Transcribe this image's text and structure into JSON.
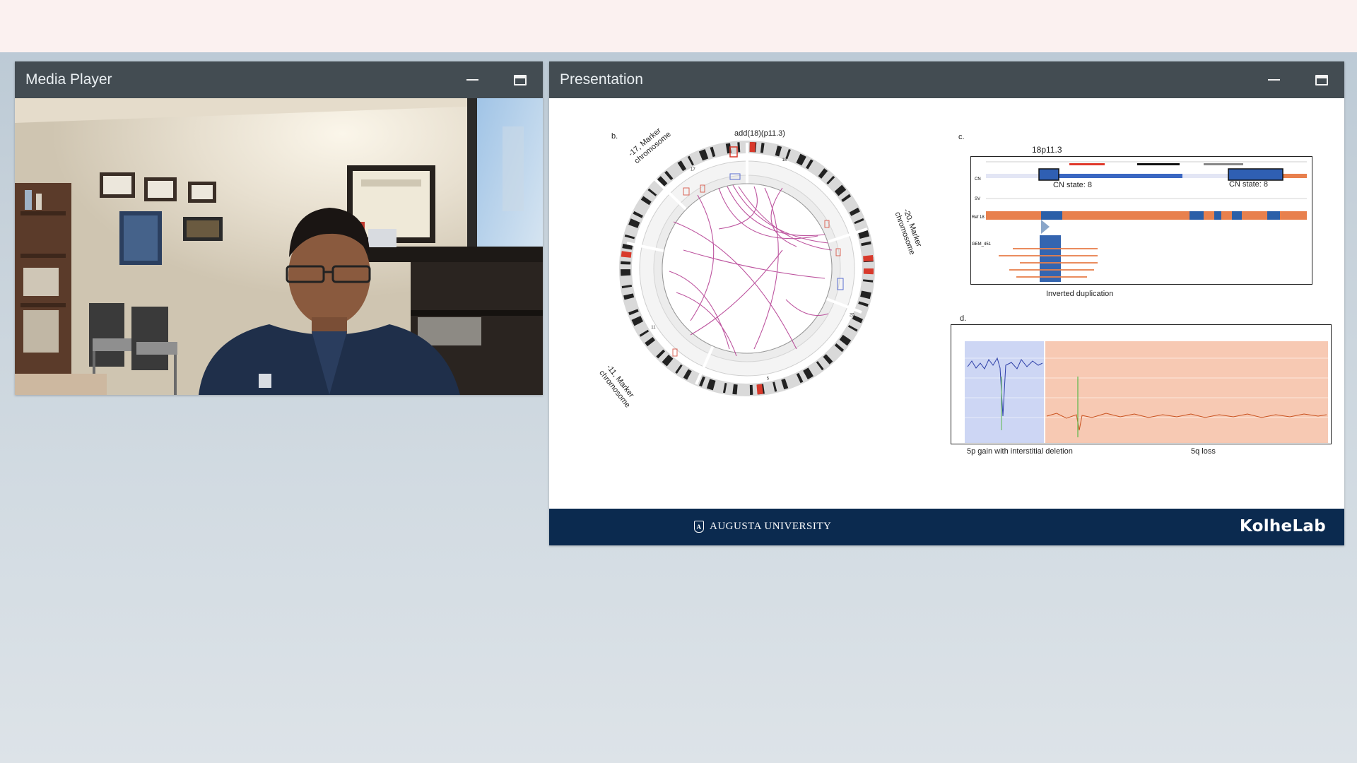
{
  "media_player": {
    "title": "Media Player"
  },
  "presentation": {
    "title": "Presentation",
    "slide": {
      "panel_b_label": "b.",
      "panel_c_label": "c.",
      "panel_d_label": "d.",
      "circos_top_label": "add(18)(p11.3)",
      "marker_17": "-17, Marker chromosome",
      "marker_20": "-20, Marker chromosome",
      "marker_11": "-11, Marker chromosome",
      "region_label": "18p11.3",
      "cn_state_left": "CN state: 8",
      "cn_state_right": "CN state: 8",
      "inverted_dup": "Inverted duplication",
      "gain_caption": "5p gain with interstitial deletion",
      "loss_caption": "5q loss",
      "track_cn": "CN",
      "track_sv": "SV",
      "track_ref": "Ref 18",
      "track_gem": "GEM_451",
      "chr_labels": [
        "18",
        "17",
        "20",
        "11",
        "5"
      ]
    },
    "footer": {
      "university": "AUGUSTA UNIVERSITY",
      "shield": "A",
      "lab": "KolheLab"
    }
  },
  "colors": {
    "footer_bg": "#0b2a4f",
    "header_bg": "#434c52",
    "cn_blue": "#2f5fb3",
    "cn_orange": "#e8804d",
    "arc_magenta": "#b2388f"
  }
}
